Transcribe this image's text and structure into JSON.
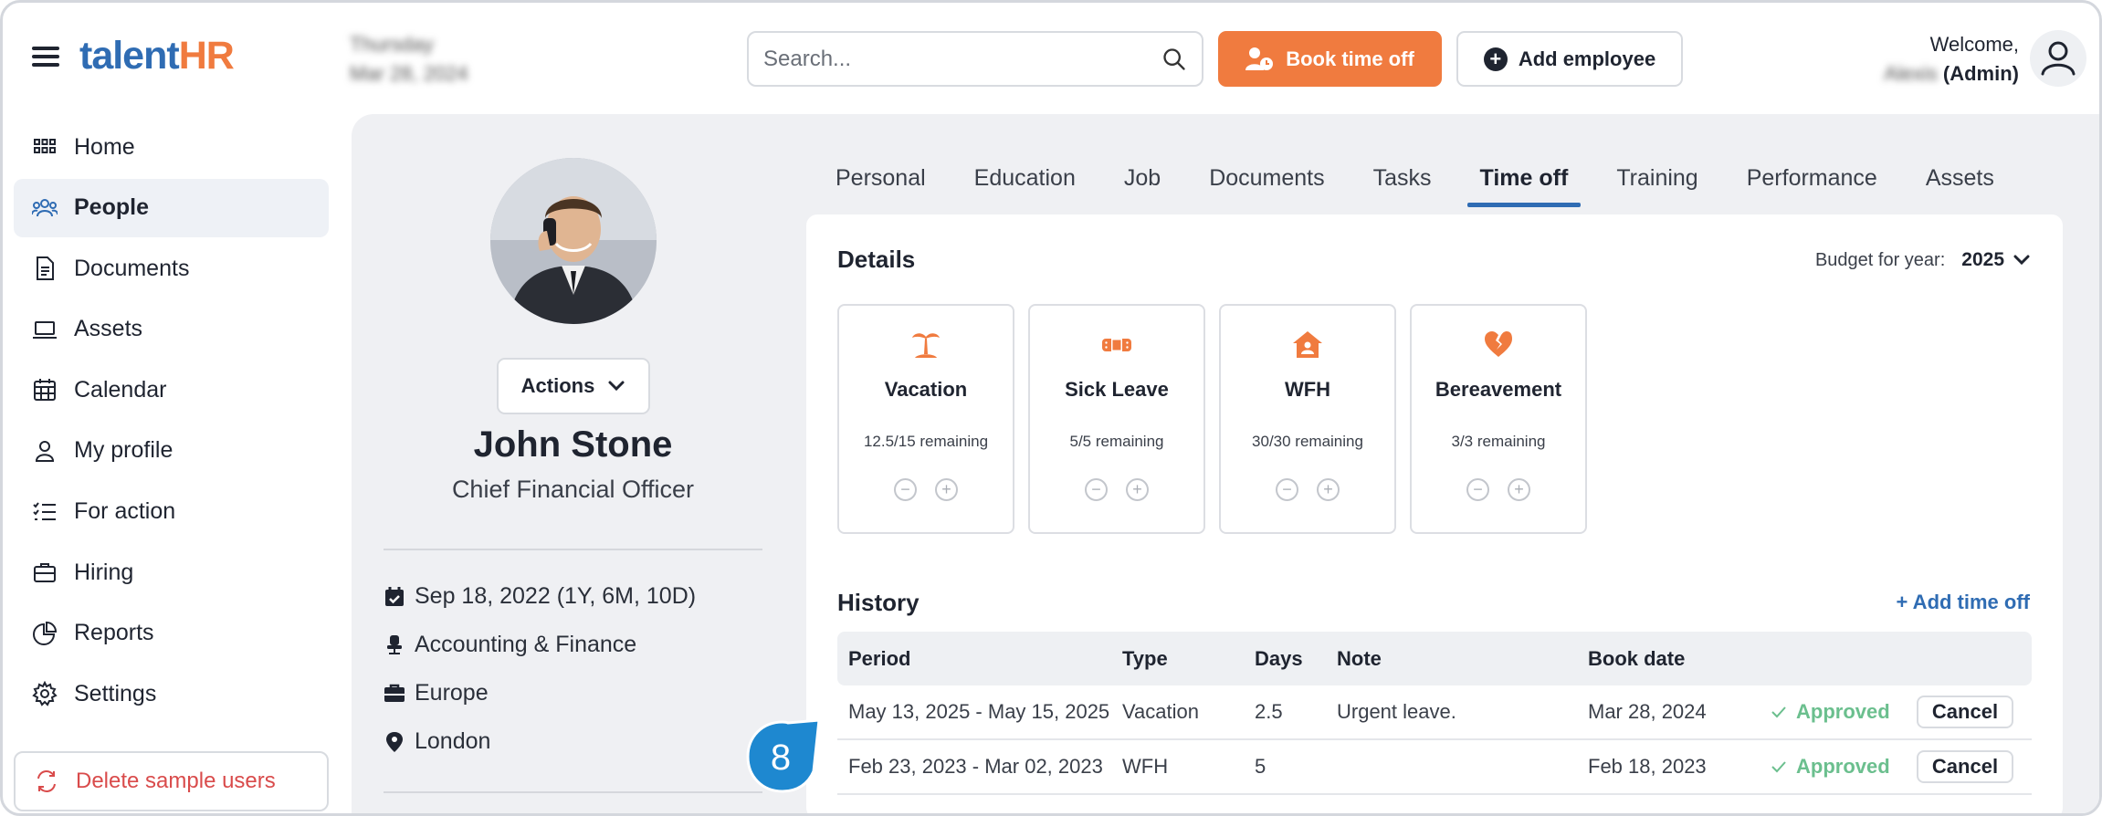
{
  "app": {
    "logo_part1": "talent",
    "logo_part2": "HR"
  },
  "header": {
    "day": "Thursday",
    "date": "Mar 28, 2024",
    "search_placeholder": "Search...",
    "book_label": "Book time off",
    "add_employee_label": "Add employee",
    "welcome": "Welcome,",
    "user_name": "Alexis",
    "role": "(Admin)"
  },
  "sidebar": {
    "items": [
      {
        "label": "Home",
        "icon": "grid-icon"
      },
      {
        "label": "People",
        "icon": "people-icon"
      },
      {
        "label": "Documents",
        "icon": "document-icon"
      },
      {
        "label": "Assets",
        "icon": "laptop-icon"
      },
      {
        "label": "Calendar",
        "icon": "calendar-icon"
      },
      {
        "label": "My profile",
        "icon": "user-icon"
      },
      {
        "label": "For action",
        "icon": "checklist-icon"
      },
      {
        "label": "Hiring",
        "icon": "briefcase-icon"
      },
      {
        "label": "Reports",
        "icon": "pie-chart-icon"
      },
      {
        "label": "Settings",
        "icon": "gear-icon"
      }
    ],
    "active": "People",
    "delete_label": "Delete sample users"
  },
  "profile": {
    "actions_label": "Actions",
    "name": "John Stone",
    "title": "Chief Financial Officer",
    "start_date": "Sep 18, 2022 (1Y, 6M, 10D)",
    "department": "Accounting & Finance",
    "region": "Europe",
    "location": "London"
  },
  "tabs": [
    "Personal",
    "Education",
    "Job",
    "Documents",
    "Tasks",
    "Time off",
    "Training",
    "Performance",
    "Assets"
  ],
  "active_tab": "Time off",
  "details": {
    "title": "Details",
    "budget_label": "Budget for year:",
    "budget_year": "2025",
    "leaves": [
      {
        "name": "Vacation",
        "remaining": "12.5/15 remaining",
        "icon": "palm-tree-icon"
      },
      {
        "name": "Sick Leave",
        "remaining": "5/5 remaining",
        "icon": "bandage-icon"
      },
      {
        "name": "WFH",
        "remaining": "30/30 remaining",
        "icon": "home-icon"
      },
      {
        "name": "Bereavement",
        "remaining": "3/3 remaining",
        "icon": "broken-heart-icon"
      }
    ]
  },
  "history": {
    "title": "History",
    "add_label": "+ Add time off",
    "columns": [
      "Period",
      "Type",
      "Days",
      "Note",
      "Book date"
    ],
    "rows": [
      {
        "period": "May 13, 2025 - May 15, 2025",
        "type": "Vacation",
        "days": "2.5",
        "note": "Urgent leave.",
        "book_date": "Mar 28, 2024",
        "status": "Approved",
        "action": "Cancel"
      },
      {
        "period": "Feb 23, 2023 - Mar 02, 2023",
        "type": "WFH",
        "days": "5",
        "note": "",
        "book_date": "Feb 18, 2023",
        "status": "Approved",
        "action": "Cancel"
      }
    ]
  },
  "callout": {
    "number": "8"
  },
  "colors": {
    "brand_blue": "#2f6cb3",
    "brand_orange": "#f07b3f",
    "approved_green": "#6bbf8e",
    "danger_red": "#d94b4b",
    "callout_blue": "#1e88d0"
  }
}
